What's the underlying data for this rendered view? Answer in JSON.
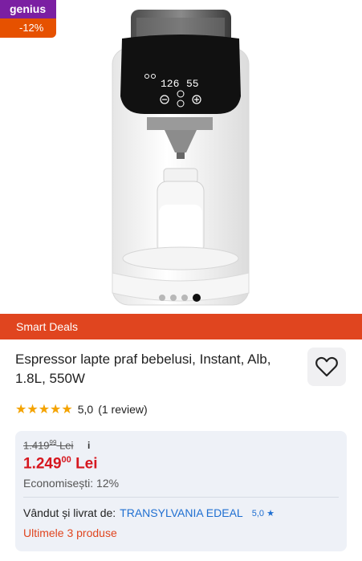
{
  "badge": {
    "genius": "genius",
    "discount": "-12%"
  },
  "machine_display": {
    "left_value": "126",
    "right_value": "55",
    "minus": "−",
    "plus": "+"
  },
  "carousel": {
    "total": 4,
    "active_index": 3
  },
  "banner": {
    "label": "Smart Deals"
  },
  "product": {
    "title": "Espressor lapte praf bebelusi, Instant, Alb, 1.8L, 550W"
  },
  "rating": {
    "stars": "★★★★★",
    "score": "5,0",
    "reviews": "(1 review)"
  },
  "price": {
    "old_main": "1.419",
    "old_cents": "99",
    "old_currency": " Lei",
    "info": "i",
    "new_main": "1.249",
    "new_cents": "00",
    "new_currency": " Lei",
    "savings": "Economisești: 12%"
  },
  "seller": {
    "prefix": "Vândut și livrat de:",
    "name": "TRANSYLVANIA EDEAL",
    "rating": "5,0 ★"
  },
  "stock": {
    "label": "Ultimele 3 produse"
  },
  "icons": {
    "favorite": "heart-outline-icon",
    "rating": "star-icon"
  },
  "colors": {
    "genius": "#7b1fa2",
    "discount": "#e65100",
    "banner": "#e0451f",
    "price": "#d6171f",
    "link": "#1f6fd1"
  }
}
